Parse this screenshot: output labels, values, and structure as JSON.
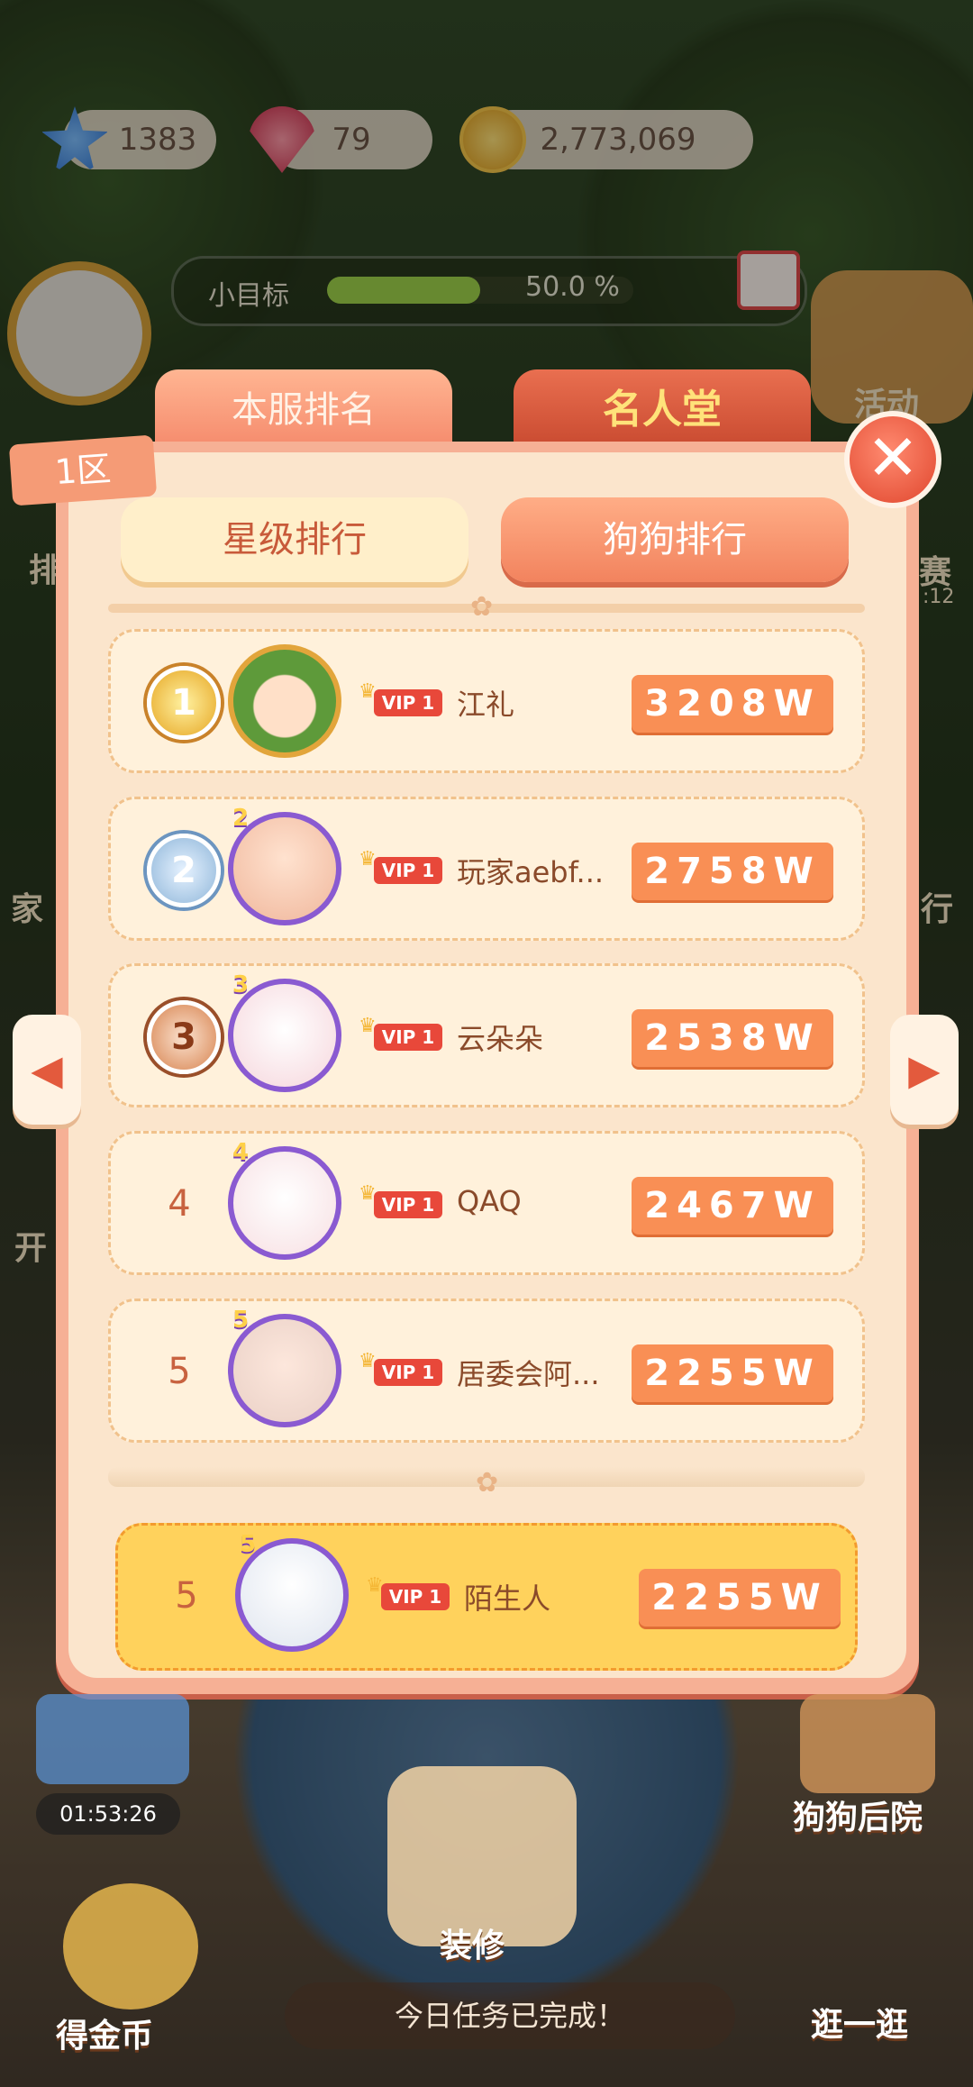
{
  "currencies": [
    {
      "name": "star",
      "value": "1383",
      "color": "#3f8fe0"
    },
    {
      "name": "gem",
      "value": "79",
      "color": "#e24d6a"
    },
    {
      "name": "coin",
      "value": "2,773,069",
      "color": "#f2b42a"
    }
  ],
  "goal": {
    "label": "小目标",
    "percent_text": "50.0 %",
    "progress": 0.5
  },
  "side": {
    "activity": "活动",
    "match": "赛",
    "timer_small": ":12",
    "left1": "排",
    "left2": "家",
    "left3": "开",
    "right1": "行"
  },
  "tabs": {
    "server_rank": "本服排名",
    "hall_of_fame": "名人堂"
  },
  "zone": "1区",
  "subtabs": {
    "star_rank": "星级排行",
    "dog_rank": "狗狗排行"
  },
  "rows": [
    {
      "rank": "1",
      "name": "江礼",
      "vip": "VIP 1",
      "score": "3208W"
    },
    {
      "rank": "2",
      "name": "玩家aebf...",
      "vip": "VIP 1",
      "score": "2758W"
    },
    {
      "rank": "3",
      "name": "云朵朵",
      "vip": "VIP 1",
      "score": "2538W"
    },
    {
      "rank": "4",
      "name": "QAQ",
      "vip": "VIP 1",
      "score": "2467W"
    },
    {
      "rank": "5",
      "name": "居委会阿...",
      "vip": "VIP 1",
      "score": "2255W"
    }
  ],
  "me": {
    "rank": "5",
    "name": "陌生人",
    "vip": "VIP 1",
    "score": "2255W"
  },
  "bottom": {
    "timer": "01:53:26",
    "backyard": "狗狗后院",
    "decorate": "装修",
    "earn_coins": "得金币",
    "stroll": "逛一逛",
    "status": "今日任务已完成！"
  }
}
